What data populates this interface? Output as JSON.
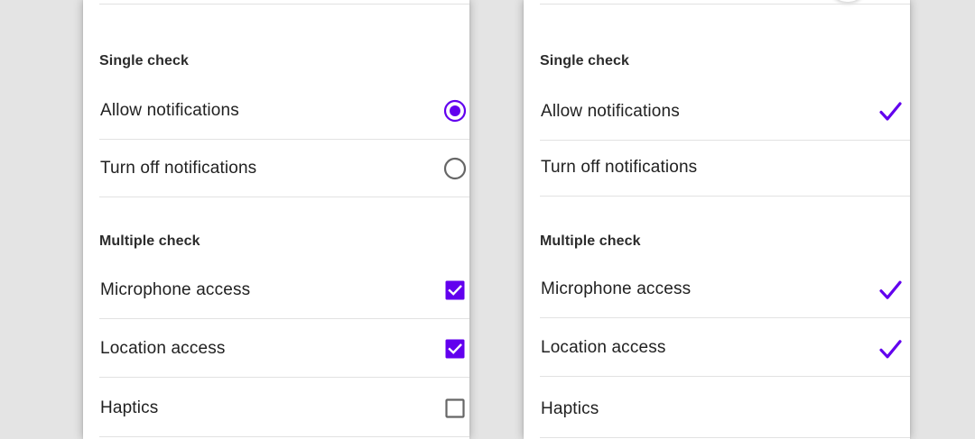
{
  "colors": {
    "accent": "#6200ee",
    "unselected": "#666666",
    "divider": "#e2e2e2",
    "background": "#e4e4e4",
    "surface": "#ffffff"
  },
  "left_panel": {
    "style": "radio-and-checkbox",
    "single": {
      "header": "Single check",
      "items": [
        {
          "label": "Allow notifications",
          "selected": true,
          "control": "radio"
        },
        {
          "label": "Turn off notifications",
          "selected": false,
          "control": "radio"
        }
      ]
    },
    "multiple": {
      "header": "Multiple check",
      "items": [
        {
          "label": "Microphone access",
          "checked": true,
          "control": "checkbox"
        },
        {
          "label": "Location access",
          "checked": true,
          "control": "checkbox"
        },
        {
          "label": "Haptics",
          "checked": false,
          "control": "checkbox"
        }
      ]
    }
  },
  "right_panel": {
    "style": "checkmark",
    "single": {
      "header": "Single check",
      "items": [
        {
          "label": "Allow notifications",
          "selected": true,
          "control": "checkmark-icon"
        },
        {
          "label": "Turn off notifications",
          "selected": false,
          "control": "checkmark-icon"
        }
      ]
    },
    "multiple": {
      "header": "Multiple check",
      "items": [
        {
          "label": "Microphone access",
          "checked": true,
          "control": "checkmark-icon"
        },
        {
          "label": "Location access",
          "checked": true,
          "control": "checkmark-icon"
        },
        {
          "label": "Haptics",
          "checked": false,
          "control": "checkmark-icon"
        }
      ]
    }
  }
}
